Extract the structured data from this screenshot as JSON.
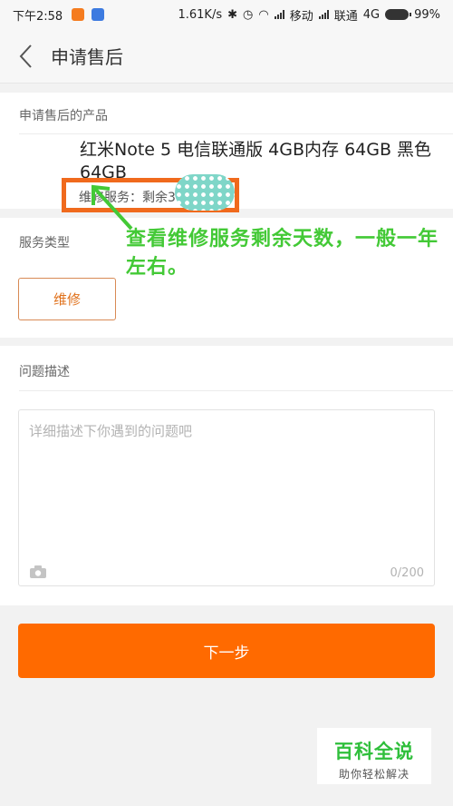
{
  "status_bar": {
    "time": "下午2:58",
    "speed": "1.61K/s",
    "carrier1": "移动",
    "carrier2": "联通",
    "network": "4G",
    "battery": "99%"
  },
  "header": {
    "title": "申请售后"
  },
  "product": {
    "section_label": "申请售后的产品",
    "name": "红米Note 5 电信联通版 4GB内存 64GB 黑色 64GB",
    "warranty": "维修服务：剩余3"
  },
  "service": {
    "section_label": "服务类型",
    "option": "维修"
  },
  "annotation": {
    "text": "查看维修服务剩余天数，一般一年左右。",
    "color": "#43c936"
  },
  "description": {
    "section_label": "问题描述",
    "placeholder": "详细描述下你遇到的问题吧",
    "counter": "0/200"
  },
  "actions": {
    "next_label": "下一步"
  },
  "watermark": {
    "main": "百科全说",
    "sub": "助你轻松解决"
  },
  "colors": {
    "accent": "#ff6a00",
    "highlight_border": "#f06a1d"
  }
}
